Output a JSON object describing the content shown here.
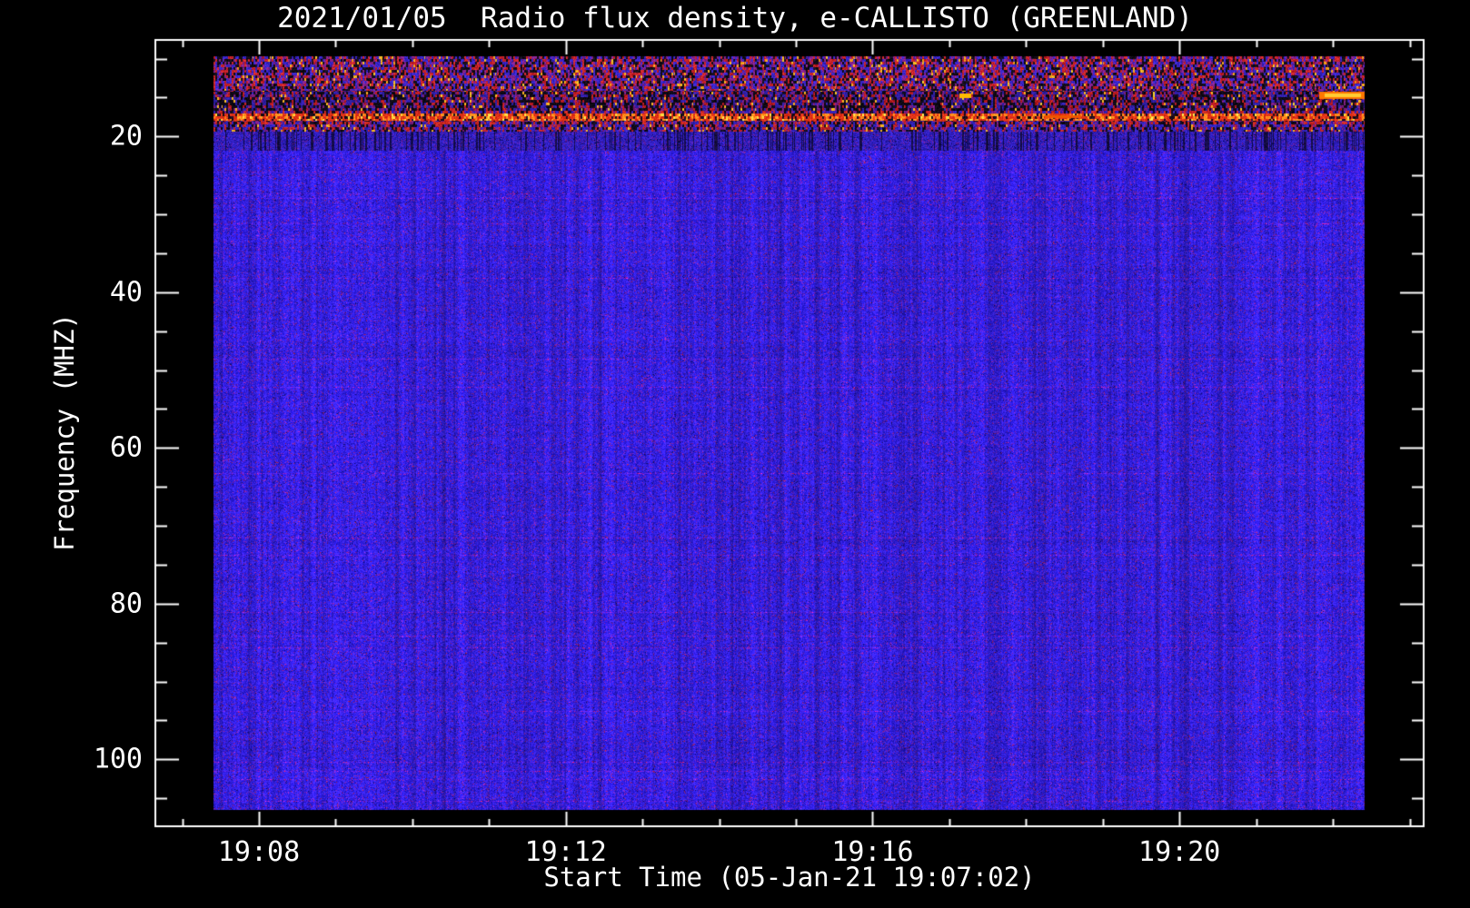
{
  "chart_data": {
    "type": "heatmap",
    "variant": "radio-spectrogram",
    "title": "2021/01/05  Radio flux density, e-CALLISTO (GREENLAND)",
    "xlabel": "Start Time (05-Jan-21 19:07:02)",
    "ylabel": "Frequency (MHZ)",
    "x_axis": {
      "start_time": "19:06:39",
      "end_time": "19:23:11",
      "major_ticks": [
        {
          "label": "19:08",
          "time": "19:08:00"
        },
        {
          "label": "19:12",
          "time": "19:12:00"
        },
        {
          "label": "19:16",
          "time": "19:16:00"
        },
        {
          "label": "19:20",
          "time": "19:20:00"
        }
      ],
      "minor_tick_interval_seconds": 60
    },
    "y_axis": {
      "unit": "MHz",
      "min": 7.6,
      "max": 108.6,
      "inverted": true,
      "major_ticks": [
        20,
        40,
        60,
        80,
        100
      ],
      "minor_tick_step": 5,
      "minor_tick_min": 10,
      "minor_tick_max": 105
    },
    "data_extent": {
      "nominal_start_time": "19:07:02",
      "freq_min_mhz": 10,
      "freq_max_mhz": 106
    },
    "bands": [
      {
        "freq_mhz": [
          10.0,
          14.4
        ],
        "desc": "strong RFI: red/blue/black mix with yellow specks"
      },
      {
        "freq_mhz": [
          14.4,
          17.0
        ],
        "desc": "dark band, black-dominated with red bursts"
      },
      {
        "freq_mhz": [
          17.0,
          18.7
        ],
        "desc": "bright continuous red-orange interference line"
      },
      {
        "freq_mhz": [
          18.7,
          19.6
        ],
        "desc": "mixed red/blue fade-out"
      },
      {
        "freq_mhz": [
          19.6,
          22.1
        ],
        "desc": "blue with dark vertical striations"
      },
      {
        "freq_mhz": [
          22.1,
          106.0
        ],
        "desc": "quiet blue background noise with purple speckle"
      }
    ],
    "highlights": [
      {
        "desc": "bright orange streak at right edge",
        "freq_mhz": 15.0,
        "near_time": "19:21:50"
      }
    ],
    "colors": {
      "background": "#000000",
      "axis": "#ffffff",
      "quiet_blue": "#2a20dc",
      "speckle_purple": "#7a1e78",
      "rfi_red": "#cc2012",
      "rfi_orange": "#ff7a00",
      "rfi_yellow": "#ffd24a"
    },
    "legend": "none",
    "grid": false
  }
}
